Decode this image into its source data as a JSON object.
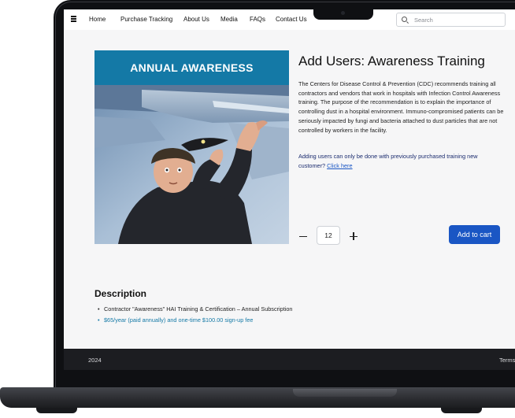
{
  "nav": {
    "items": [
      {
        "label": "Home"
      },
      {
        "label": "Purchase Tracking"
      },
      {
        "label": "About Us"
      },
      {
        "label": "Media"
      },
      {
        "label": "FAQs"
      },
      {
        "label": "Contact Us"
      }
    ],
    "search_placeholder": "Search"
  },
  "product": {
    "image_banner": "ANNUAL AWARENESS",
    "title": "Add Users: Awareness Training",
    "description": "The Centers for Disease Control & Prevention (CDC) recommends training all contractors and vendors that work in hospitals with Infection Control Awareness training.  The purpose of the recommendation is to explain the importance of controlling dust in a hospital environment.  Immuno-compromised patients can be seriously impacted by fungi and bacteria attached to dust particles that are not controlled by workers in the facility.",
    "note": "Adding users can only be done with previously purchased training new customer?",
    "note_link": "Click here",
    "quantity": "12",
    "add_to_cart_label": "Add to cart"
  },
  "description_section": {
    "heading": "Description",
    "items": [
      {
        "text": "Contractor \"Awareness\" HAI Training & Certification – Annual Subscription"
      },
      {
        "text": "$65/year (paid annually) and one-time $100.00 sign-up fee"
      }
    ]
  },
  "footer": {
    "year": "2024",
    "terms": "Terms"
  },
  "colors": {
    "accent": "#1a56c4",
    "banner": "#1479a6",
    "footer": "#1c1d21"
  }
}
